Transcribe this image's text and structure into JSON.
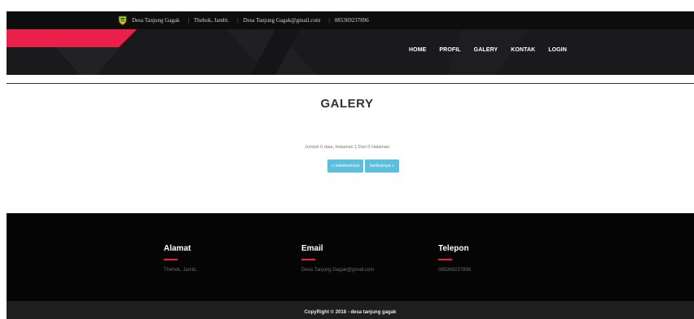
{
  "topbar": {
    "site_name": "Desa Tanjung Gagak",
    "location": "Thehok, Jambi.",
    "email": "Desa Tanjung Gagak@gmail.com",
    "phone": "085369237896",
    "separator": "|"
  },
  "nav": {
    "items": [
      "HOME",
      "PROFIL",
      "GALERY",
      "KONTAK",
      "LOGIN"
    ]
  },
  "main": {
    "title": "GALERY",
    "info": "Jumlah 0 data, Halaman 1 Dari 0 Halaman",
    "prev_label": "« sebelumnya",
    "next_label": "berikutnya »"
  },
  "footer": {
    "address_title": "Alamat",
    "address_value": "Thehok, Jambi.",
    "email_title": "Email",
    "email_value": "Desa Tanjung Gagak@gmail.com",
    "phone_title": "Telepon",
    "phone_value": "085369237896",
    "copyright": "CopyRight © 2018 - desa tanjung gagak"
  },
  "colors": {
    "accent": "#e8204a",
    "pager": "#5bc0de"
  },
  "icons": {
    "logo": "village-emblem-icon"
  }
}
